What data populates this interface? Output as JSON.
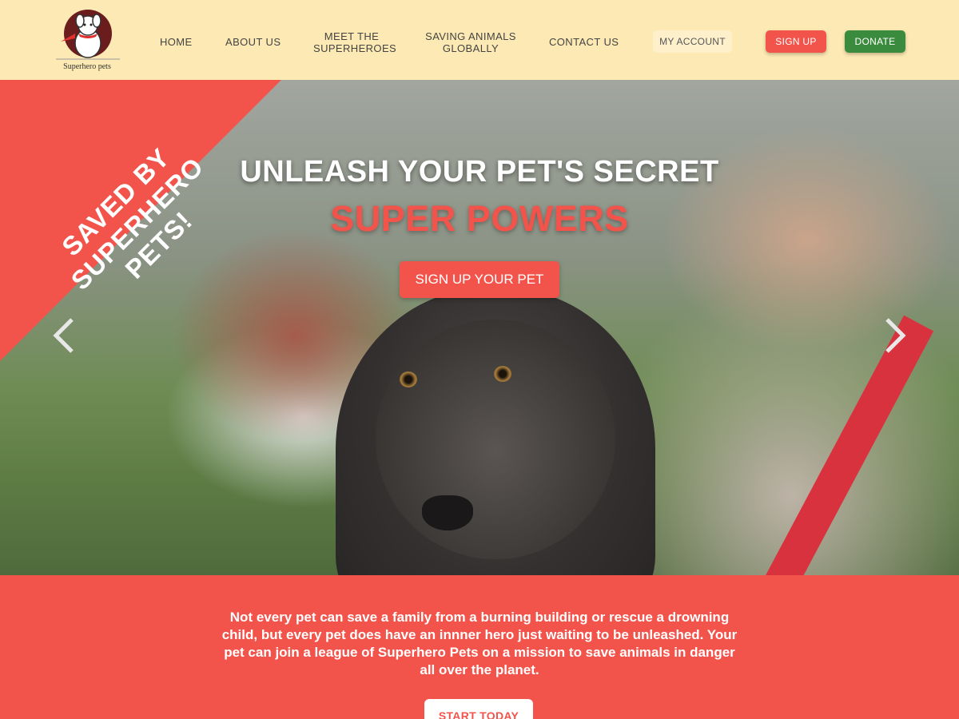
{
  "header": {
    "logo_text": "Superhero pets",
    "nav": [
      {
        "label": "HOME"
      },
      {
        "label": "ABOUT US"
      },
      {
        "label_line1": "MEET THE",
        "label_line2": "SUPERHEROES"
      },
      {
        "label_line1": "SAVING ANIMALS",
        "label_line2": "GLOBALLY"
      },
      {
        "label": "CONTACT US"
      }
    ],
    "my_account": "MY ACCOUNT",
    "sign_up": "SIGN UP",
    "donate": "DONATE"
  },
  "hero": {
    "corner_banner_line1": "SAVED BY",
    "corner_banner_line2": "SUPERHERO PETS!",
    "headline": "UNLEASH YOUR PET'S SECRET",
    "subheadline": "SUPER POWERS",
    "cta": "SIGN UP YOUR PET",
    "prev_icon": "chevron-left-icon",
    "next_icon": "chevron-right-icon"
  },
  "intro": {
    "text_part1": "Not every pet can save a family from a burning building or rescue a drowning child, but every pet does have an innner hero just waiting to be unleashed. Your pet can join a league of ",
    "text_bold": "Superhero Pets",
    "text_part2": " on a mission to save animals in danger all over the planet.",
    "cta": "START TODAY"
  },
  "colors": {
    "accent": "#f2544b",
    "header_bg": "#fde9b3",
    "donate": "#3b8b3e"
  }
}
